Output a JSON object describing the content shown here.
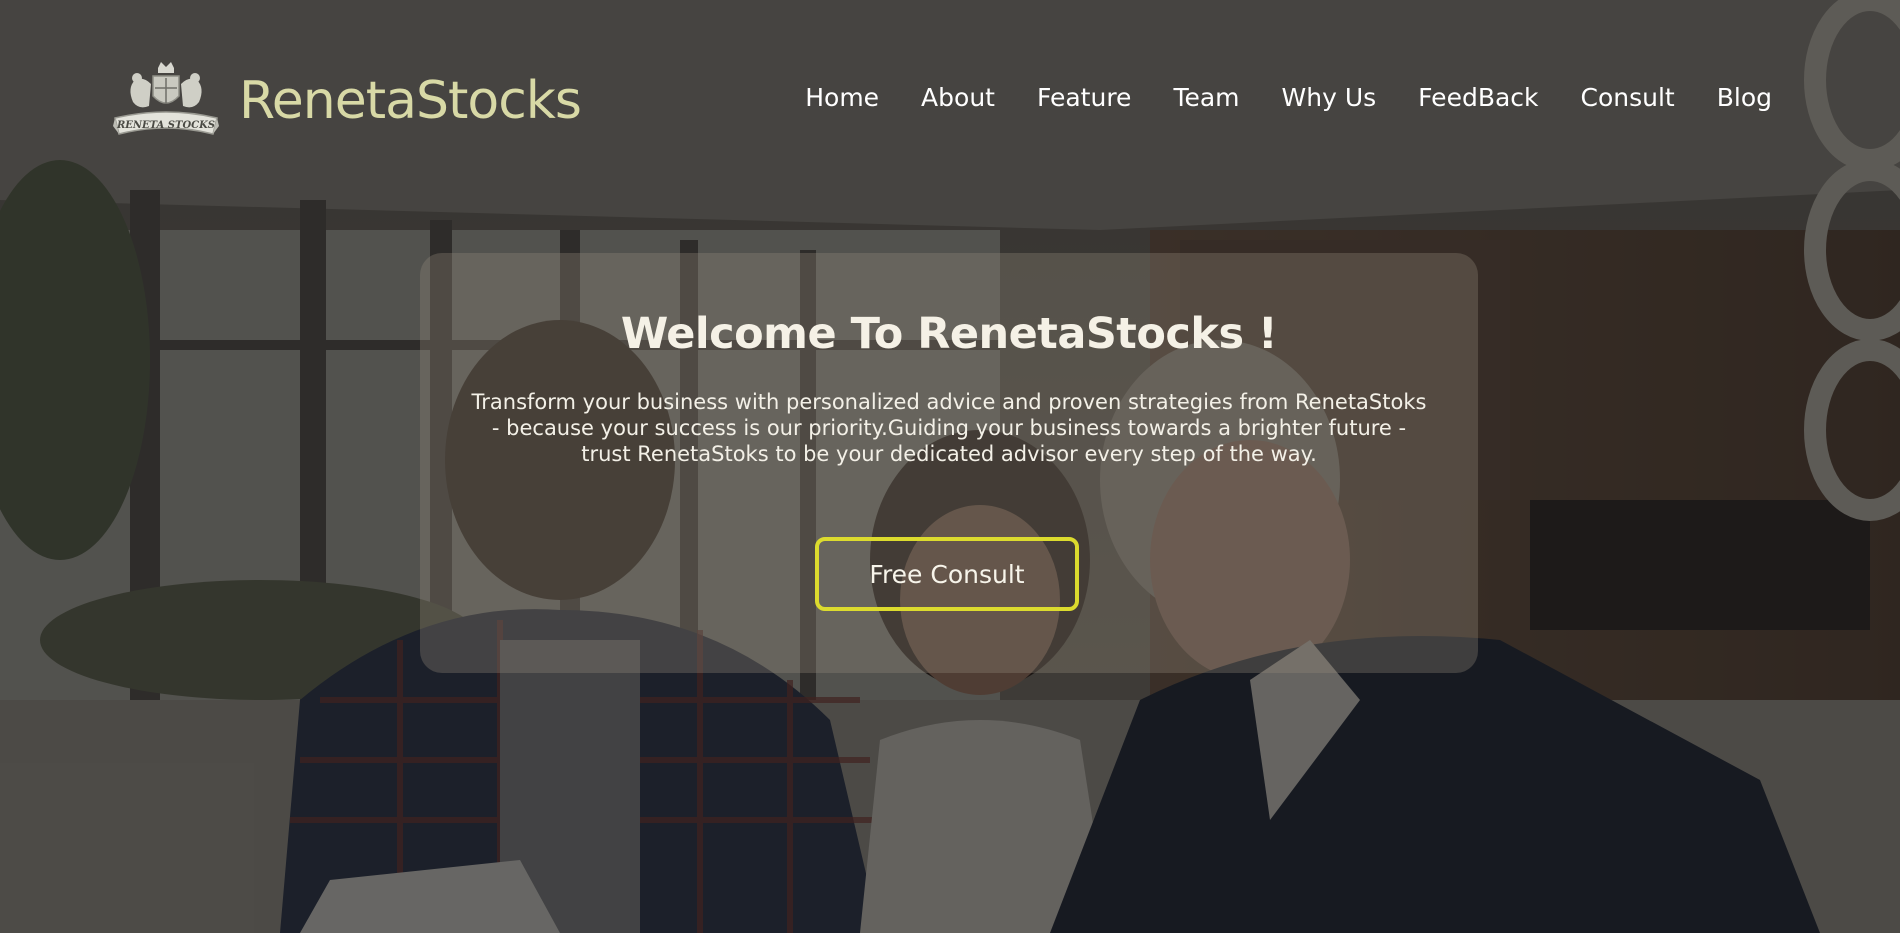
{
  "brand": {
    "name": "RenetaStocks",
    "logo_text": "RENETA STOCKS",
    "logo_icon": "heraldic-crest-icon"
  },
  "nav": {
    "items": [
      {
        "label": "Home"
      },
      {
        "label": "About"
      },
      {
        "label": "Feature"
      },
      {
        "label": "Team"
      },
      {
        "label": "Why Us"
      },
      {
        "label": "FeedBack"
      },
      {
        "label": "Consult"
      },
      {
        "label": "Blog"
      }
    ]
  },
  "hero": {
    "title": "Welcome To RenetaStocks !",
    "description": "Transform your business with personalized advice and proven strategies from RenetaStoks - because your success is our priority.Guiding your business towards a brighter future - trust RenetaStoks to be your dedicated advisor every step of the way.",
    "cta_label": "Free Consult"
  },
  "colors": {
    "brand_text": "#d8d9a6",
    "cta_border": "#dcdb2e",
    "nav_text": "#ffffff"
  }
}
